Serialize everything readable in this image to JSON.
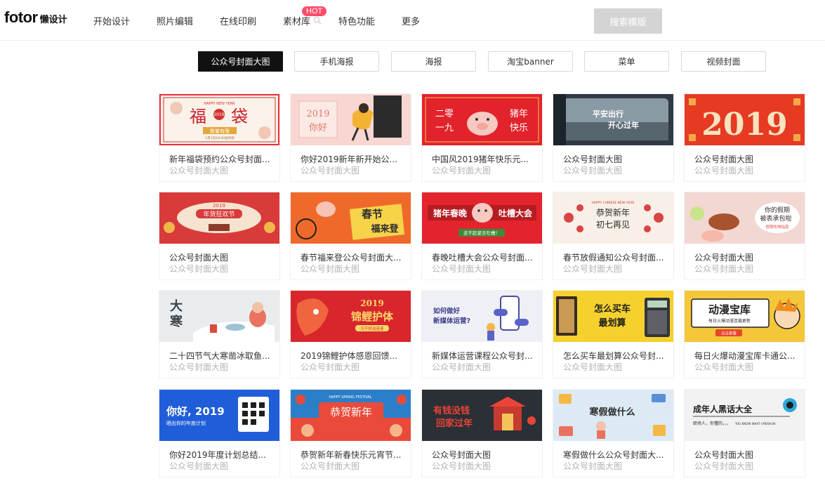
{
  "header": {
    "logo_main": "fotor",
    "logo_sub": "懒设计",
    "nav": [
      "开始设计",
      "照片编辑",
      "在线印刷",
      "素材库",
      "特色功能",
      "更多"
    ],
    "hot_badge": "HOT",
    "search_button": "搜索模版"
  },
  "tabs": [
    {
      "label": "公众号封面大图",
      "active": true
    },
    {
      "label": "手机海报",
      "active": false
    },
    {
      "label": "海报",
      "active": false
    },
    {
      "label": "淘宝banner",
      "active": false
    },
    {
      "label": "菜单",
      "active": false
    },
    {
      "label": "视频封面",
      "active": false
    }
  ],
  "thumb_text": {
    "c0": [
      "HAPPY NEW YEAR",
      "福",
      "袋",
      "2019",
      "数量有限",
      "1月1日18:00准时领"
    ],
    "c1": [
      "2019",
      "你好"
    ],
    "c2": [
      "二零",
      "一九",
      "猪年",
      "快乐"
    ],
    "c3": [
      "平安出行",
      "开心过年"
    ],
    "c4": [
      "2019"
    ],
    "c5": [
      "2019",
      "年货狂欢节"
    ],
    "c6": [
      "春节",
      "福来登"
    ],
    "c7": [
      "猪年春晚",
      "吐槽大会",
      "还不赶紧去吐槽！"
    ],
    "c8": [
      "HAPPY CHINESE NEW YEAR",
      "恭贺新年",
      "初七再见"
    ],
    "c9": [
      "你的假期",
      "被表承包啦",
      "假期吃喝指南"
    ],
    "c10": [
      "大",
      "寒"
    ],
    "c11": [
      "2019",
      "锦鲤护体",
      "万千好运连连"
    ],
    "c12": [
      "如何做好",
      "新媒体运营?"
    ],
    "c13": [
      "怎么买车",
      "最划算"
    ],
    "c14": [
      "动漫宝库",
      "每日火爆动漫连载更新",
      "点击查看"
    ],
    "c15": [
      "你好, 2019",
      "晒出你的年度计划"
    ],
    "c16": [
      "HAPPY SPRING FESTIVAL",
      "恭贺新年"
    ],
    "c17": [
      "有钱没钱",
      "回家过年"
    ],
    "c18": [
      "寒假做什么"
    ],
    "c19": [
      "成年人黑话大全",
      "职场人，你懂的。。。",
      "YOU KNOW WHAT I MEAN BA"
    ]
  },
  "cards": [
    {
      "title": "新年福袋预约公众号封面...",
      "subtitle": "公众号封面大图"
    },
    {
      "title": "你好2019新年新开始公...",
      "subtitle": "公众号封面大图"
    },
    {
      "title": "中国风2019猪年快乐元...",
      "subtitle": "公众号封面大图"
    },
    {
      "title": "公众号封面大图",
      "subtitle": "公众号封面大图"
    },
    {
      "title": "公众号封面大图",
      "subtitle": "公众号封面大图"
    },
    {
      "title": "公众号封面大图",
      "subtitle": "公众号封面大图"
    },
    {
      "title": "春节福来登公众号封面大...",
      "subtitle": "公众号封面大图"
    },
    {
      "title": "春晚吐槽大会公众号封面...",
      "subtitle": "公众号封面大图"
    },
    {
      "title": "春节放假通知公众号封面...",
      "subtitle": "公众号封面大图"
    },
    {
      "title": "公众号封面大图",
      "subtitle": "公众号封面大图"
    },
    {
      "title": "二十四节气大寒凿冰取鱼...",
      "subtitle": "公众号封面大图"
    },
    {
      "title": "2019锦鲤护体感恩回馈...",
      "subtitle": "公众号封面大图"
    },
    {
      "title": "新媒体运营课程公众号封...",
      "subtitle": "公众号封面大图"
    },
    {
      "title": "怎么买车最划算公众号封...",
      "subtitle": "公众号封面大图"
    },
    {
      "title": "每日火爆动漫宝库卡通公...",
      "subtitle": "公众号封面大图"
    },
    {
      "title": "你好2019年度计划总结...",
      "subtitle": "公众号封面大图"
    },
    {
      "title": "恭贺新年新春快乐元宵节...",
      "subtitle": "公众号封面大图"
    },
    {
      "title": "公众号封面大图",
      "subtitle": "公众号封面大图"
    },
    {
      "title": "寒假做什么公众号封面大...",
      "subtitle": "公众号封面大图"
    },
    {
      "title": "公众号封面大图",
      "subtitle": "公众号封面大图"
    }
  ]
}
